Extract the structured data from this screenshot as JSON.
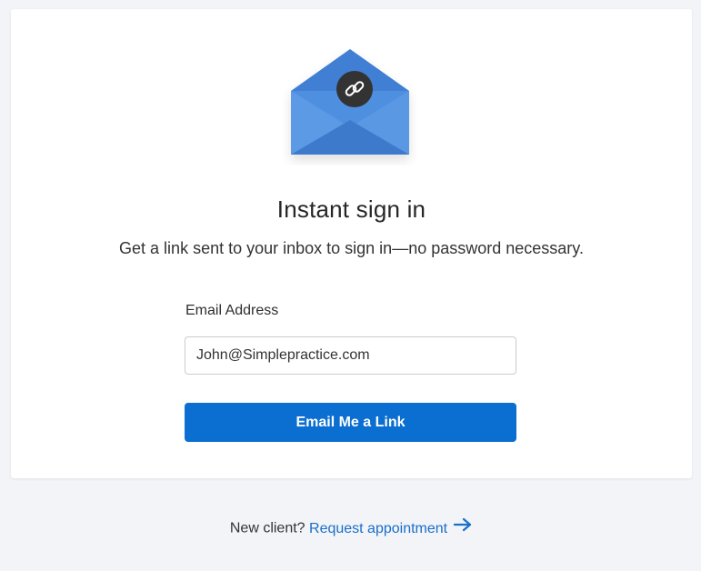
{
  "header": {
    "title": "Instant sign in",
    "subtitle": "Get a link sent to your inbox to sign in—no password necessary."
  },
  "form": {
    "email_label": "Email Address",
    "email_value": "John@Simplepractice.com",
    "submit_label": "Email Me a Link"
  },
  "footer": {
    "prompt": "New client?",
    "link_label": "Request appointment",
    "link_icon": "arrow-right-icon"
  },
  "hero": {
    "icon": "envelope-link-icon"
  },
  "colors": {
    "accent": "#0b6fd1",
    "link": "#1a6fca",
    "envelope": "#4a90e2",
    "badge": "#333333",
    "footer_bg": "#f2f4f7"
  }
}
